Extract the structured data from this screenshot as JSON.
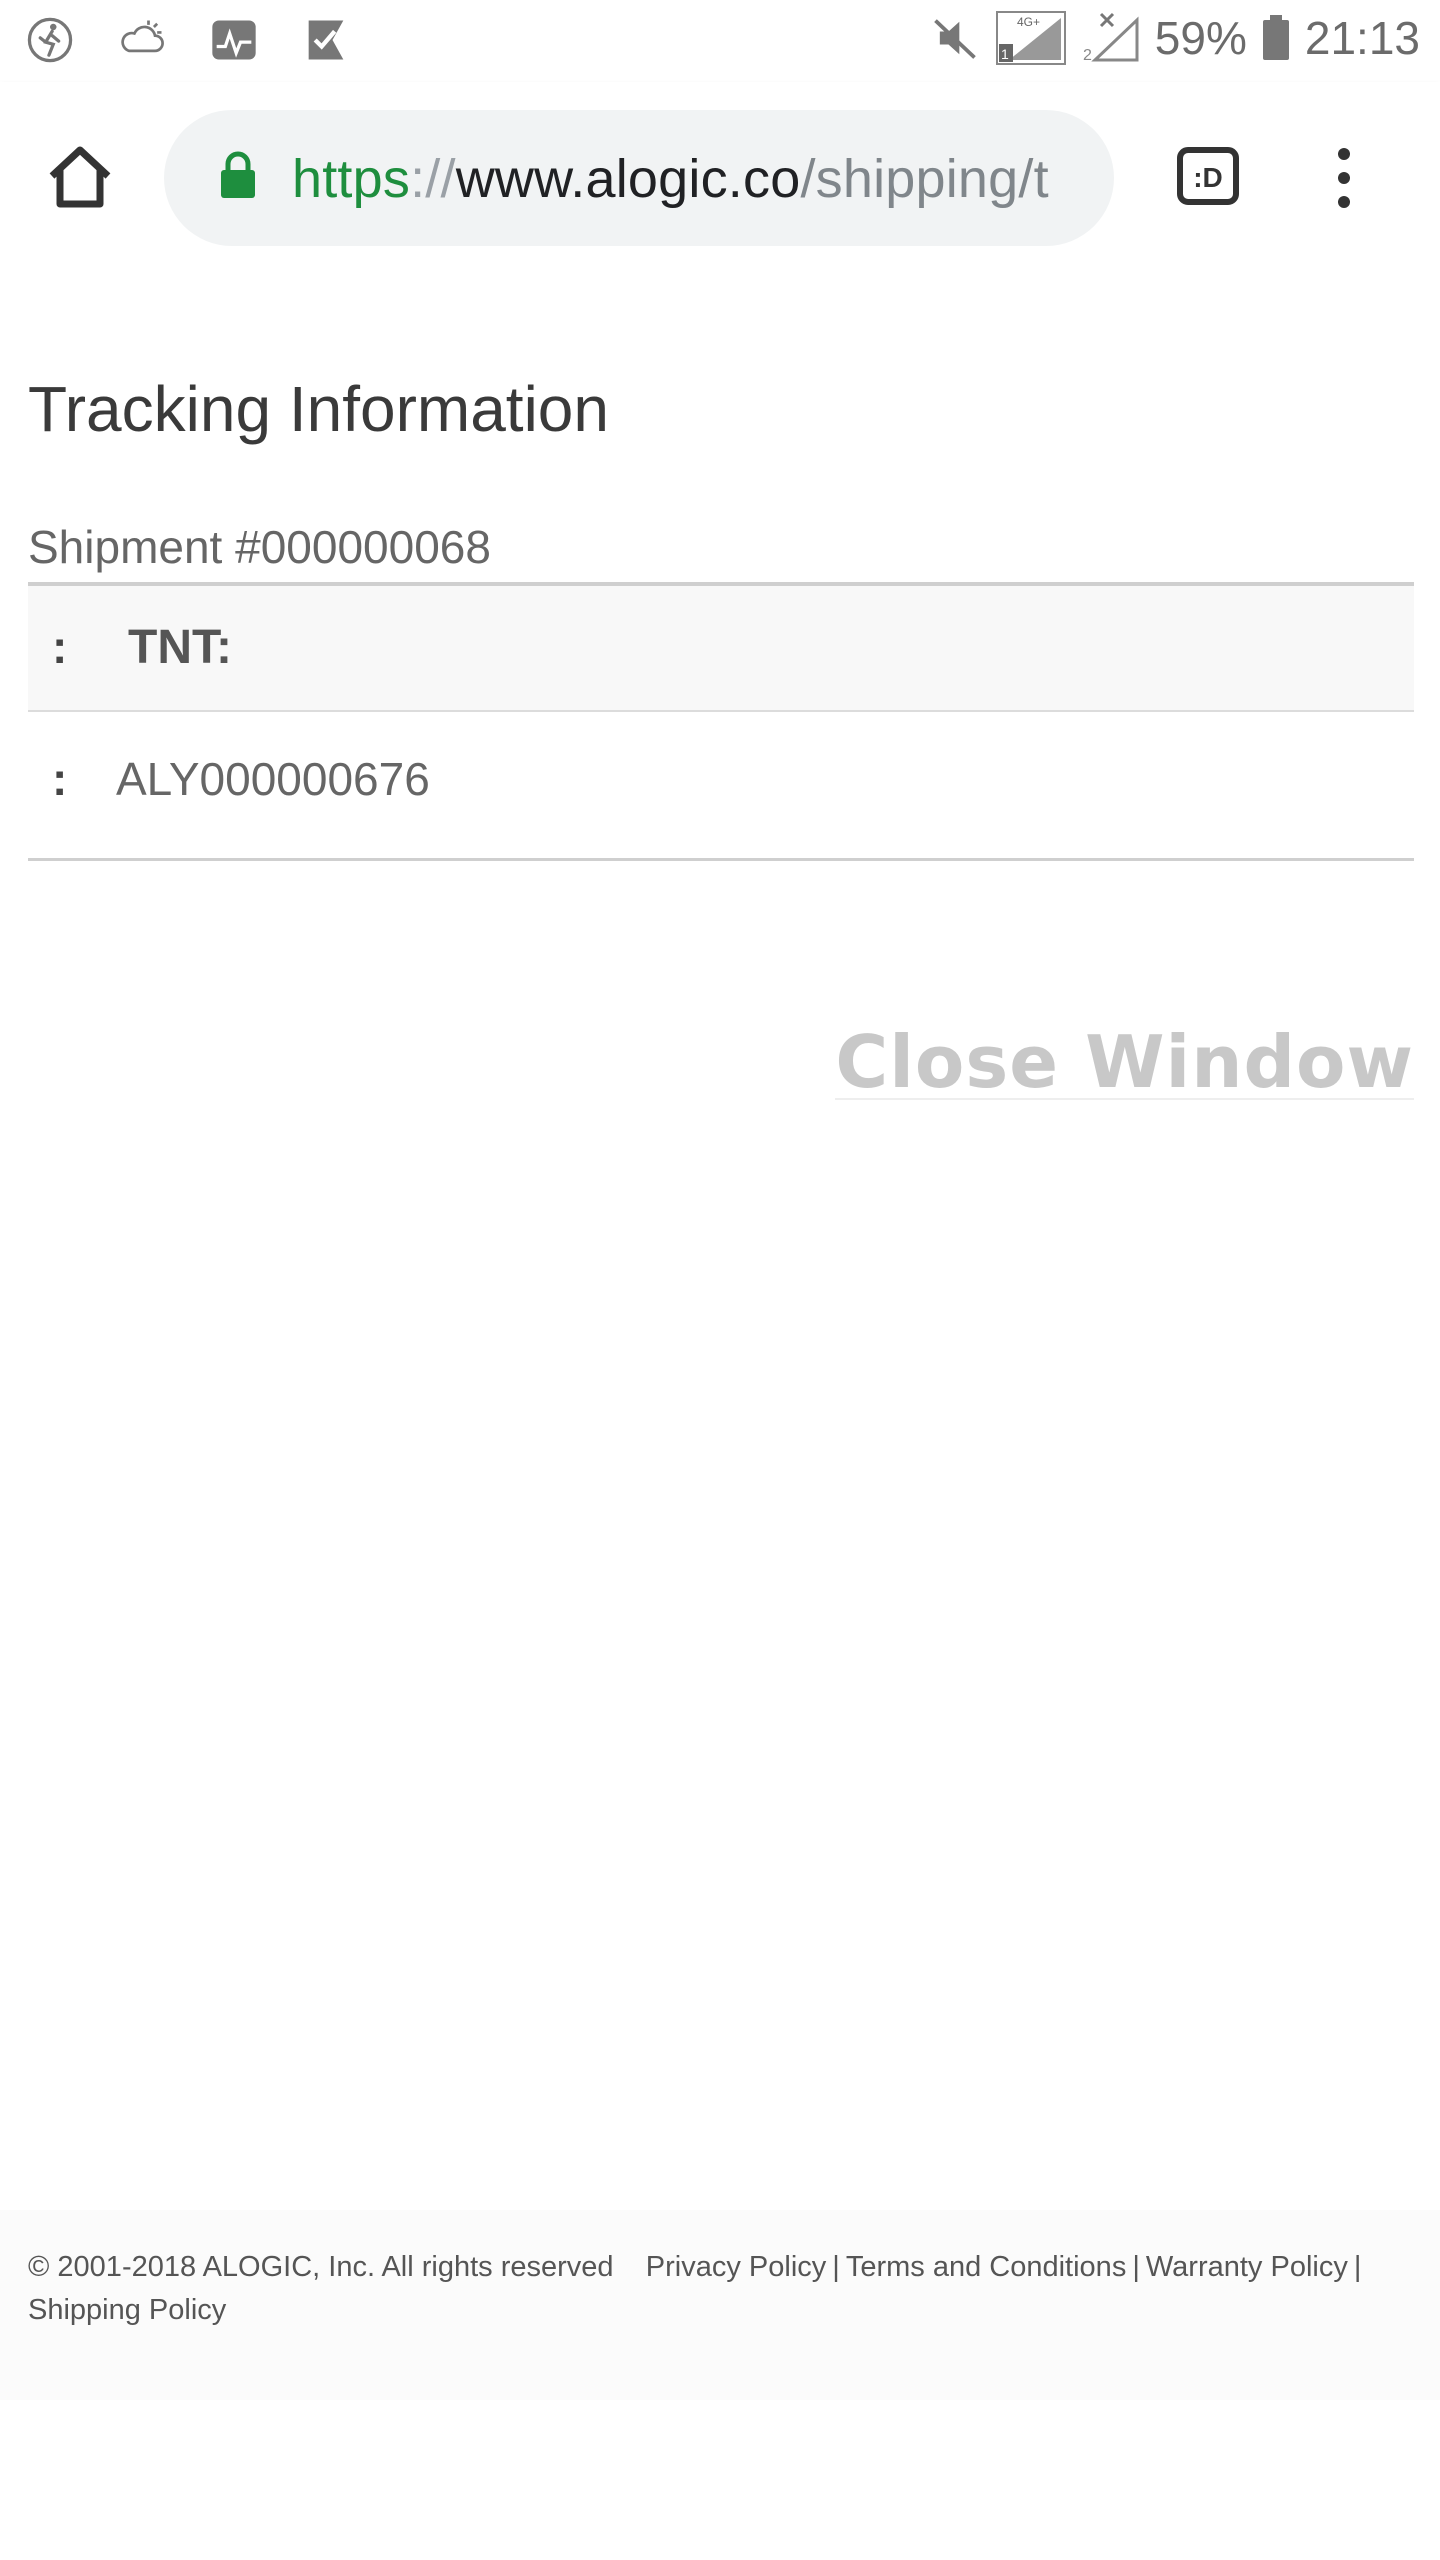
{
  "status_bar": {
    "left_icons": [
      "activity-icon",
      "weather-cloud-icon",
      "health-app-icon",
      "task-check-icon"
    ],
    "right_icons": [
      "mute-icon",
      "signal-sim1-icon",
      "signal-sim2-icon",
      "battery-icon"
    ],
    "network_label": "4G+",
    "battery": "59%",
    "time": "21:13"
  },
  "browser": {
    "url_scheme": "https",
    "url_separator": "://",
    "url_host": "www.alogic.co",
    "url_path": "/shipping/t",
    "tab_switcher_label": ":D",
    "accent_green": "#1e8e3e"
  },
  "page": {
    "title": "Tracking Information",
    "shipment_label": "Shipment #000000068",
    "carrier_row": {
      "colon": ":",
      "carrier": "TNT:"
    },
    "number_row": {
      "colon": ":",
      "tracking_number": "ALY000000676"
    },
    "close_window": "Close Window"
  },
  "footer": {
    "copyright": "© 2001-2018 ALOGIC, Inc. All rights reserved",
    "links": {
      "privacy": "Privacy Policy",
      "terms": "Terms and Conditions",
      "warranty": "Warranty Policy",
      "shipping": "Shipping Policy"
    },
    "separator": "|"
  }
}
